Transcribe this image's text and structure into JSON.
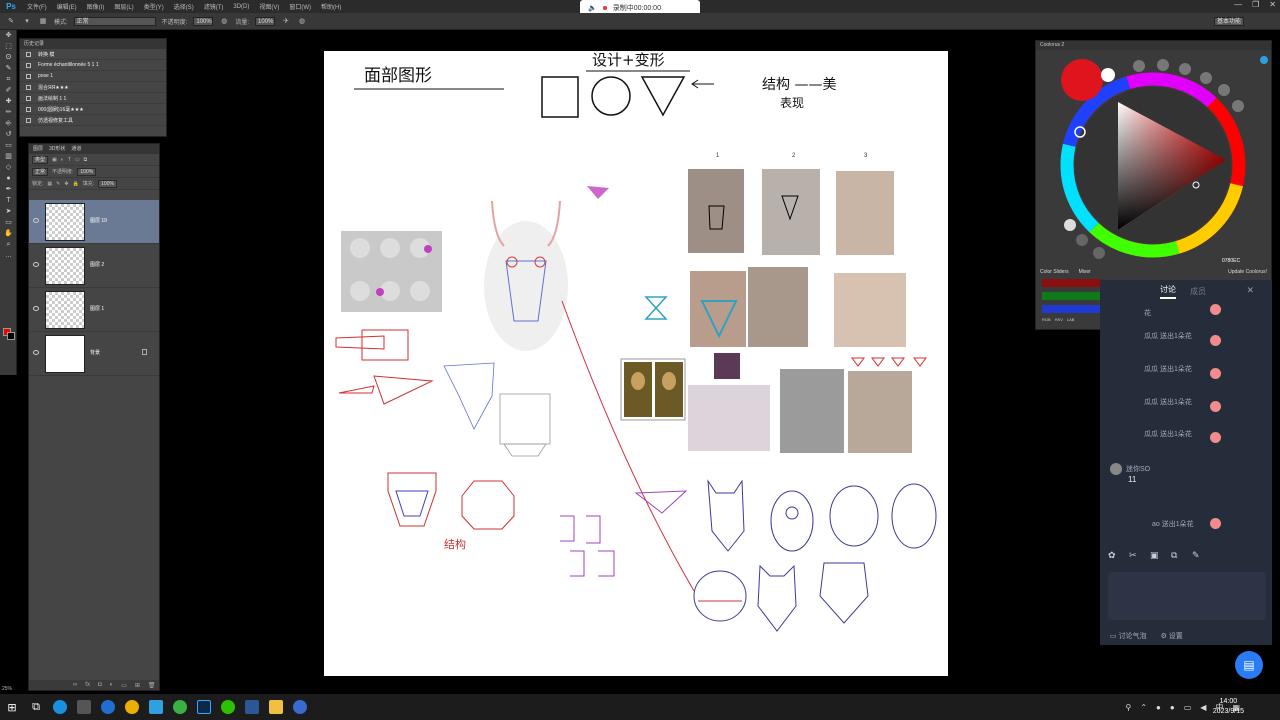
{
  "app": {
    "logo": "Ps",
    "menu": [
      "文件(F)",
      "编辑(E)",
      "图像(I)",
      "图层(L)",
      "类型(Y)",
      "选择(S)",
      "滤镜(T)",
      "3D(D)",
      "视图(V)",
      "窗口(W)",
      "帮助(H)"
    ],
    "window_buttons": [
      "—",
      "❐",
      "✕"
    ]
  },
  "recording": {
    "label": "录制中00:00:00"
  },
  "options_bar": {
    "mode_label": "模式:",
    "mode_value": "正常",
    "opacity_label": "不透明度:",
    "opacity_value": "100%",
    "flow_label": "流量:",
    "flow_value": "100%",
    "workspace": "基本功能"
  },
  "history": {
    "tab": "历史记录",
    "items": [
      "转换 模",
      "Forme échantillonnée 5 1 1",
      "pose 1",
      "混合ЯЯ★★★",
      "画法绘制 1 1",
      "000(圆刷)16毫★★★",
      "仿透视修复工具"
    ]
  },
  "layers": {
    "tabs": [
      "图层",
      "3D形状",
      "通道"
    ],
    "kind_label": "类型",
    "blend": "正常",
    "opacity_label": "不透明度:",
    "opacity": "100%",
    "lock_label": "锁定:",
    "fill_label": "填充:",
    "fill": "100%",
    "items": [
      {
        "name": "图层 19",
        "active": true
      },
      {
        "name": "图层 2",
        "active": false
      },
      {
        "name": "图层 1",
        "active": false
      },
      {
        "name": "背景",
        "active": false
      }
    ]
  },
  "status": {
    "zoom": "25%"
  },
  "canvas_notes": {
    "left_title": "面部图形",
    "top_title": "设计+变形",
    "right_title": "结构 ——美",
    "right_sub": "表现",
    "num1": "1",
    "num2": "2",
    "num3": "3",
    "label_lower": "结构"
  },
  "color_panel": {
    "title": "Coolorus 2",
    "sliders_tab": "Color Sliders",
    "mixer_tab": "Mixer",
    "update": "Update Coolorus!",
    "hex": "0780EC",
    "modes": [
      "RGB",
      "HSV",
      "LAB"
    ],
    "colors": {
      "foreground": "#e0141c",
      "background": "#ffffff"
    }
  },
  "chat": {
    "tab_active": "讨论",
    "tab_inactive": "成员",
    "gifts": [
      "花",
      "瓜瓜 送出1朵花",
      "瓜瓜 送出1朵花",
      "瓜瓜 送出1朵花",
      "瓜瓜 送出1朵花"
    ],
    "user": "迷你SO",
    "message": "11",
    "gift_last": "ao 送出1朵花",
    "footer_bubble": "讨论气泡",
    "footer_settings": "设置"
  },
  "taskbar": {
    "time": "14:00",
    "date": "2023/9/15",
    "ime": "中"
  }
}
